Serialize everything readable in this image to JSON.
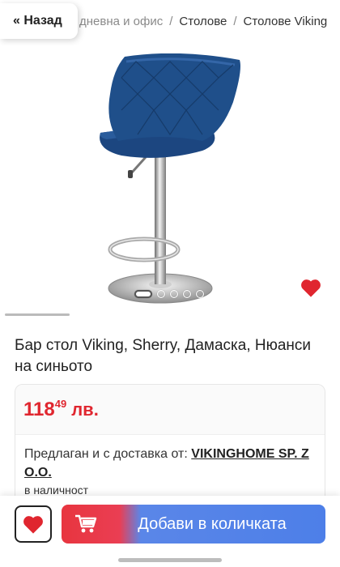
{
  "nav": {
    "back_label": "« Назад",
    "breadcrumbs": [
      {
        "label": "дневна и офис"
      },
      {
        "label": "Столове"
      },
      {
        "label": "Столове Viking"
      }
    ],
    "separator": "/"
  },
  "gallery": {
    "image_count": 5,
    "active_index": 0
  },
  "product": {
    "title": "Бар стол Viking, Sherry, Дамаска, Нюанси на синьото",
    "price_whole": "118",
    "price_cents": "49",
    "currency": "лв.",
    "seller_prefix": "Предлаган и с доставка от:",
    "seller_name": "VIKINGHOME SP. Z O.O.",
    "stock": "в наличност"
  },
  "actions": {
    "add_to_cart_label": "Добави в количката"
  },
  "colors": {
    "accent_red": "#e0262f",
    "accent_blue": "#4d7fe8",
    "chair_blue": "#1f4f8a"
  }
}
